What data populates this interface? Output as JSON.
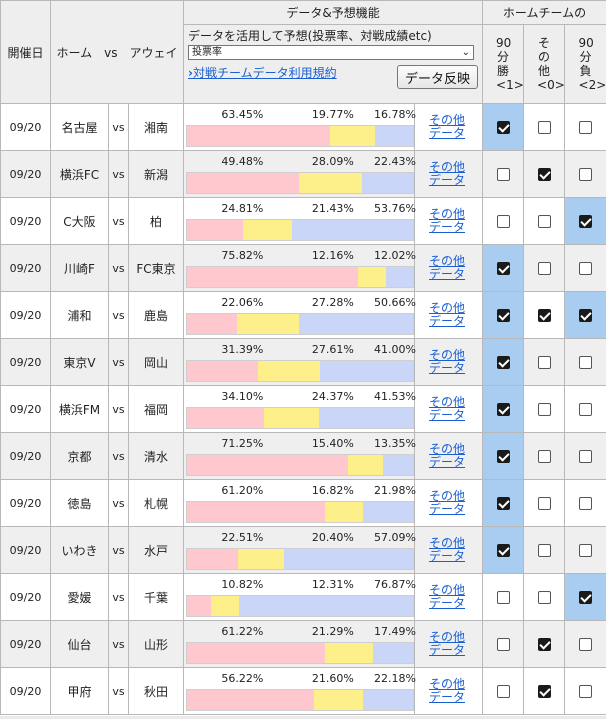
{
  "header": {
    "date_label": "開催日",
    "matchup_label": "ホーム　vs　アウェイ",
    "data_feature_label": "データ&予想機能",
    "home_team_label": "ホームチームの",
    "col_win": [
      "90",
      "分",
      "勝",
      "<1>"
    ],
    "col_other": [
      "そ",
      "の",
      "他",
      "<0>"
    ],
    "col_lose": [
      "90",
      "分",
      "負",
      "<2>"
    ],
    "predict_desc": "データを活用して予想(投票率、対戦成績etc)",
    "select_value": "投票率",
    "terms_link": "対戦チームデータ利用規約",
    "reflect_button": "データ反映"
  },
  "colors": {
    "home": "#ffc7ce",
    "draw": "#fdf08a",
    "away": "#c9d6f7",
    "selected_cell": "#a9cdf0",
    "link": "#1a5fd1"
  },
  "more_label_1": "その他",
  "more_label_2": "データ",
  "matches": [
    {
      "date": "09/20",
      "home": "名古屋",
      "vs": "vs",
      "away": "湘南",
      "p1": "63.45%",
      "p0": "19.77%",
      "p2": "16.78%",
      "v1": 63.45,
      "v0": 19.77,
      "v2": 16.78,
      "win": true,
      "other": false,
      "lose": false
    },
    {
      "date": "09/20",
      "home": "横浜FC",
      "vs": "vs",
      "away": "新潟",
      "p1": "49.48%",
      "p0": "28.09%",
      "p2": "22.43%",
      "v1": 49.48,
      "v0": 28.09,
      "v2": 22.43,
      "win": false,
      "other": true,
      "lose": false
    },
    {
      "date": "09/20",
      "home": "C大阪",
      "vs": "vs",
      "away": "柏",
      "p1": "24.81%",
      "p0": "21.43%",
      "p2": "53.76%",
      "v1": 24.81,
      "v0": 21.43,
      "v2": 53.76,
      "win": false,
      "other": false,
      "lose": true
    },
    {
      "date": "09/20",
      "home": "川崎F",
      "vs": "vs",
      "away": "FC東京",
      "p1": "75.82%",
      "p0": "12.16%",
      "p2": "12.02%",
      "v1": 75.82,
      "v0": 12.16,
      "v2": 12.02,
      "win": true,
      "other": false,
      "lose": false
    },
    {
      "date": "09/20",
      "home": "浦和",
      "vs": "vs",
      "away": "鹿島",
      "p1": "22.06%",
      "p0": "27.28%",
      "p2": "50.66%",
      "v1": 22.06,
      "v0": 27.28,
      "v2": 50.66,
      "win": true,
      "other": true,
      "lose": true
    },
    {
      "date": "09/20",
      "home": "東京V",
      "vs": "vs",
      "away": "岡山",
      "p1": "31.39%",
      "p0": "27.61%",
      "p2": "41.00%",
      "v1": 31.39,
      "v0": 27.61,
      "v2": 41.0,
      "win": true,
      "other": false,
      "lose": false
    },
    {
      "date": "09/20",
      "home": "横浜FM",
      "vs": "vs",
      "away": "福岡",
      "p1": "34.10%",
      "p0": "24.37%",
      "p2": "41.53%",
      "v1": 34.1,
      "v0": 24.37,
      "v2": 41.53,
      "win": true,
      "other": false,
      "lose": false
    },
    {
      "date": "09/20",
      "home": "京都",
      "vs": "vs",
      "away": "清水",
      "p1": "71.25%",
      "p0": "15.40%",
      "p2": "13.35%",
      "v1": 71.25,
      "v0": 15.4,
      "v2": 13.35,
      "win": true,
      "other": false,
      "lose": false
    },
    {
      "date": "09/20",
      "home": "徳島",
      "vs": "vs",
      "away": "札幌",
      "p1": "61.20%",
      "p0": "16.82%",
      "p2": "21.98%",
      "v1": 61.2,
      "v0": 16.82,
      "v2": 21.98,
      "win": true,
      "other": false,
      "lose": false
    },
    {
      "date": "09/20",
      "home": "いわき",
      "vs": "vs",
      "away": "水戸",
      "p1": "22.51%",
      "p0": "20.40%",
      "p2": "57.09%",
      "v1": 22.51,
      "v0": 20.4,
      "v2": 57.09,
      "win": true,
      "other": false,
      "lose": false
    },
    {
      "date": "09/20",
      "home": "愛媛",
      "vs": "vs",
      "away": "千葉",
      "p1": "10.82%",
      "p0": "12.31%",
      "p2": "76.87%",
      "v1": 10.82,
      "v0": 12.31,
      "v2": 76.87,
      "win": false,
      "other": false,
      "lose": true
    },
    {
      "date": "09/20",
      "home": "仙台",
      "vs": "vs",
      "away": "山形",
      "p1": "61.22%",
      "p0": "21.29%",
      "p2": "17.49%",
      "v1": 61.22,
      "v0": 21.29,
      "v2": 17.49,
      "win": false,
      "other": true,
      "lose": false
    },
    {
      "date": "09/20",
      "home": "甲府",
      "vs": "vs",
      "away": "秋田",
      "p1": "56.22%",
      "p0": "21.60%",
      "p2": "22.18%",
      "v1": 56.22,
      "v0": 21.6,
      "v2": 22.18,
      "win": false,
      "other": true,
      "lose": false
    }
  ]
}
